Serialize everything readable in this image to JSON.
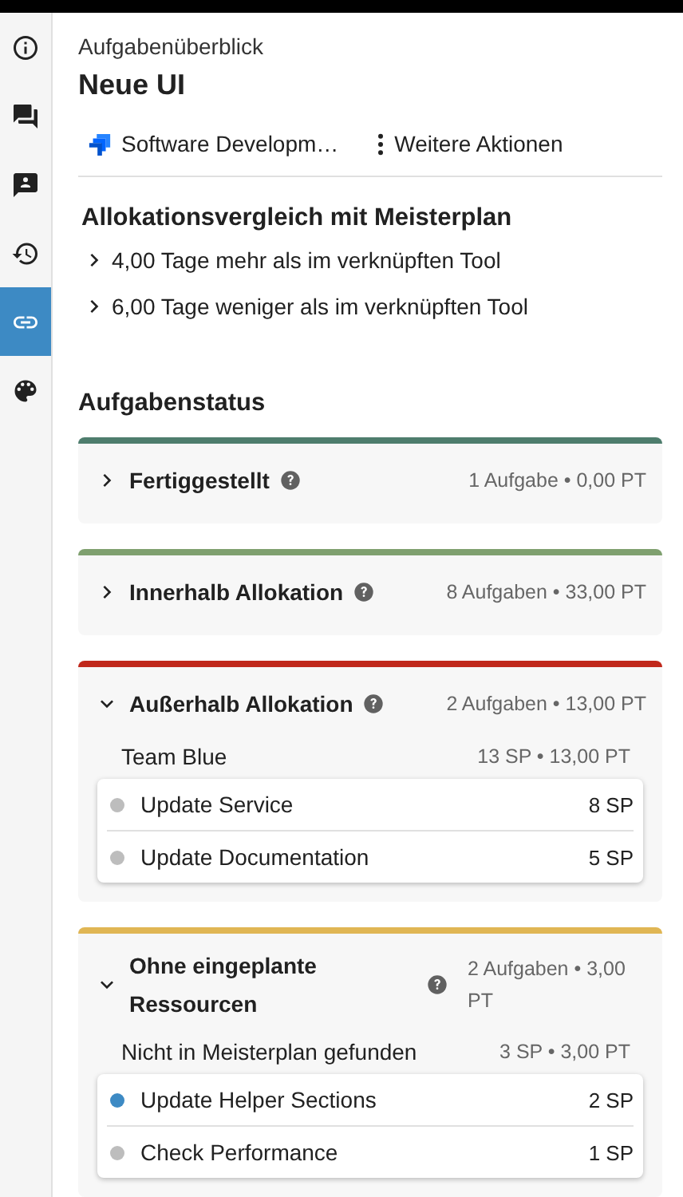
{
  "sidebar": {
    "items": [
      {
        "kind": "info",
        "selected": false
      },
      {
        "kind": "chat",
        "selected": false
      },
      {
        "kind": "contact",
        "selected": false
      },
      {
        "kind": "history",
        "selected": false
      },
      {
        "kind": "link",
        "selected": true
      },
      {
        "kind": "palette",
        "selected": false
      }
    ]
  },
  "header": {
    "overline": "Aufgabenüberblick",
    "title": "Neue UI",
    "actions": [
      {
        "kind": "jira",
        "label": "Software Developm…"
      },
      {
        "kind": "more",
        "label": "Weitere Aktionen"
      }
    ]
  },
  "comparison": {
    "title": "Allokationsvergleich mit Meisterplan",
    "items": [
      {
        "text": "4,00 Tage mehr als im verknüpften Tool",
        "expanded": false
      },
      {
        "text": "6,00 Tage weniger als im verknüpften Tool",
        "expanded": false
      }
    ]
  },
  "status": {
    "title": "Aufgabenstatus",
    "groups": [
      {
        "title": "Fertiggestellt",
        "summary": "1 Aufgabe • 0,00 PT",
        "color": "#4e7d6d",
        "expanded": false
      },
      {
        "title": "Innerhalb Allokation",
        "summary": "8 Aufgaben • 33,00 PT",
        "color": "#7fa06f",
        "expanded": false
      },
      {
        "title": "Außerhalb Allokation",
        "summary": "2 Aufgaben • 13,00 PT",
        "color": "#c0281b",
        "expanded": true,
        "teams": [
          {
            "name": "Team Blue",
            "summary": "13 SP • 13,00 PT",
            "tasks": [
              {
                "name": "Update Service",
                "points": "8 SP",
                "color": "#bdbdbd"
              },
              {
                "name": "Update Documentation",
                "points": "5 SP",
                "color": "#bdbdbd"
              }
            ]
          }
        ]
      },
      {
        "title": "Ohne eingeplante Ressourcen",
        "summary": "2 Aufgaben • 3,00 PT",
        "color": "#e0b654",
        "expanded": true,
        "teams": [
          {
            "name": "Nicht in Meisterplan gefunden",
            "summary": "3 SP • 3,00 PT",
            "tasks": [
              {
                "name": "Update Helper Sections",
                "points": "2 SP",
                "color": "#3d8ac4"
              },
              {
                "name": "Check Performance",
                "points": "1 SP",
                "color": "#bdbdbd"
              }
            ]
          }
        ]
      }
    ]
  }
}
